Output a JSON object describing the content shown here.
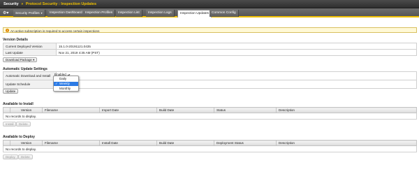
{
  "header": {
    "title_prefix": "Security",
    "separator": "»",
    "crumb1": "Protocol Security",
    "crumb_sep": ":",
    "crumb2": "Inspection Updates"
  },
  "tabs": [
    {
      "label": "Security Profiles",
      "has_menu": true
    },
    {
      "label": "Inspection Dashboard"
    },
    {
      "label": "Inspection Profiles"
    },
    {
      "label": "Inspection List"
    },
    {
      "label": "Inspection Logs"
    },
    {
      "label": "Inspection Updates",
      "active": true
    },
    {
      "label": "Common Config"
    }
  ],
  "alert": {
    "icon": "warning-icon",
    "message": "An active subscription is required to access certain inspections"
  },
  "version_details": {
    "title": "Version Details",
    "rows": [
      {
        "key": "Current Deployed Version",
        "value": "15.1.0-20191121.0435"
      },
      {
        "key": "Last Update",
        "value": "Nov 21, 2019 4:35 AM (PST)"
      }
    ],
    "download_button": "Download Package"
  },
  "auto_update": {
    "title": "Automatic Update Settings",
    "rows": [
      {
        "key": "Automatic Download and Install",
        "value": "Enabled"
      },
      {
        "key": "Update Schedule",
        "value": ""
      }
    ],
    "update_button": "Update",
    "schedule_options": [
      "Daily",
      "Weekly",
      "Monthly"
    ],
    "schedule_selected": "Weekly"
  },
  "available_install": {
    "title": "Available to Install",
    "columns": [
      "",
      "Version",
      "Filename",
      "Import Date",
      "Build Date",
      "Status",
      "Description"
    ],
    "empty_text": "No records to display.",
    "buttons": [
      "Install",
      "Delete"
    ]
  },
  "available_deploy": {
    "title": "Available to Deploy",
    "columns": [
      "",
      "Version",
      "Filename",
      "Install Date",
      "Build Date",
      "Deployment Status",
      "Description"
    ],
    "empty_text": "No records to display.",
    "buttons": [
      "Deploy",
      "Delete"
    ]
  }
}
